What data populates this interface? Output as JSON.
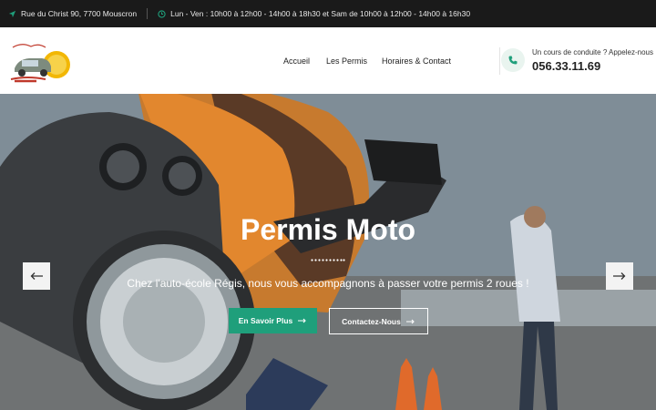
{
  "topbar": {
    "address": "Rue du Christ 90, 7700 Mouscron",
    "hours": "Lun - Ven : 10h00 à 12h00 - 14h00 à 18h30 et Sam de 10h00 à 12h00 - 14h00 à 16h30"
  },
  "logo": {
    "script_text": "Mon permis, c'est...",
    "brand": "Régis",
    "badge": "AUTO-ÉCOLE"
  },
  "nav": {
    "items": [
      "Accueil",
      "Les Permis",
      "Horaires & Contact"
    ]
  },
  "cta": {
    "label": "Un cours de conduite ? Appelez-nous",
    "phone": "056.33.11.69"
  },
  "hero": {
    "title": "Permis Moto",
    "subtitle": "Chez l'auto-école Régis, nous vous accompagnons à passer votre permis 2 roues !",
    "primary_button": "En Savoir Plus",
    "secondary_button": "Contactez-Nous"
  },
  "colors": {
    "accent": "#1f9f7b",
    "topbar_bg": "#1a1a1a"
  },
  "icons": {
    "address": "location-arrow-icon",
    "hours": "clock-icon",
    "phone": "phone-icon",
    "prev": "arrow-left-icon",
    "next": "arrow-right-icon"
  }
}
